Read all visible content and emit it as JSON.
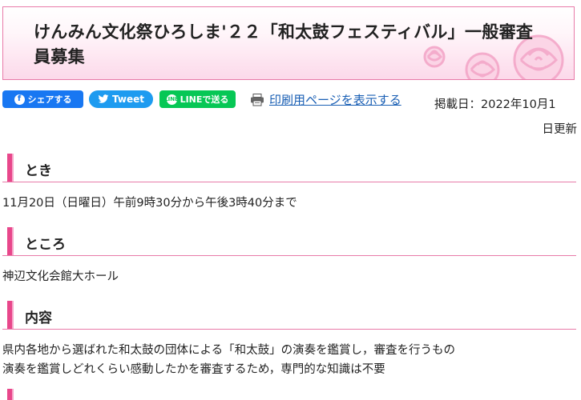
{
  "title": "けんみん文化祭ひろしま'２２「和太鼓フェスティバル」一般審査員募集",
  "share": {
    "facebook_label": "シェアする",
    "twitter_label": "Tweet",
    "line_label": "LINEで送る",
    "facebook_icon": "f",
    "line_icon": "LINE"
  },
  "print_link": "印刷用ページを表示する",
  "published": {
    "line1": "掲載日：2022年10月1",
    "line2": "日更新"
  },
  "sections": [
    {
      "heading": "とき",
      "body": [
        "11月20日（日曜日）午前9時30分から午後3時40分まで"
      ]
    },
    {
      "heading": "ところ",
      "body": [
        "神辺文化会館大ホール"
      ]
    },
    {
      "heading": "内容",
      "body": [
        "県内各地から選ばれた和太鼓の団体による「和太鼓」の演奏を鑑賞し，審査を行うもの",
        "演奏を鑑賞しどれくらい感動したかを審査するため，専門的な知識は不要"
      ]
    }
  ],
  "colors": {
    "accent_pink": "#e8478b",
    "border_pink": "#e87aa8",
    "link_blue": "#1a5fb4",
    "facebook": "#1877f2",
    "twitter": "#1d9bf0",
    "line": "#06c755"
  }
}
